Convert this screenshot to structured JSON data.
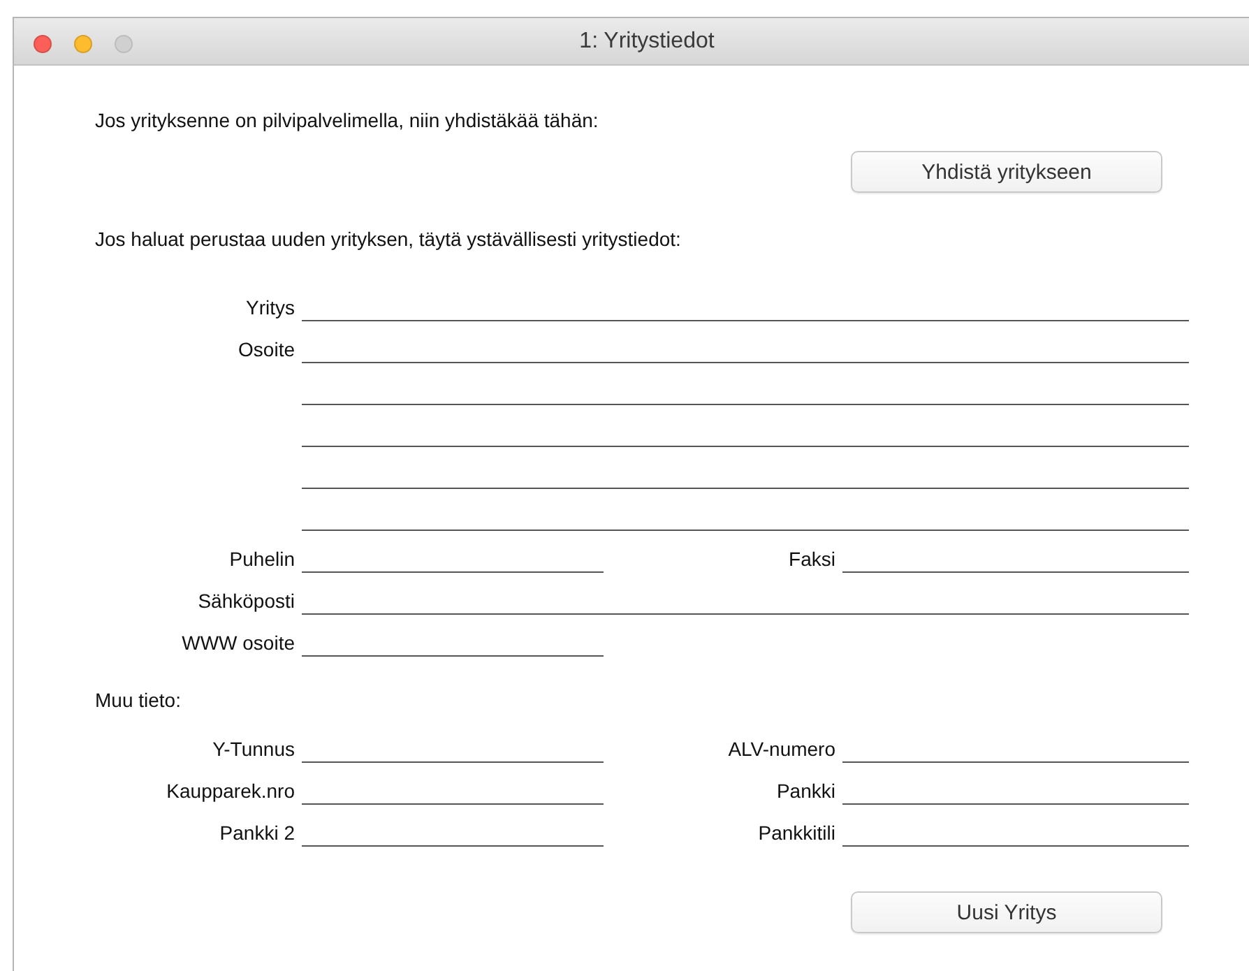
{
  "window": {
    "title": "1: Yritystiedot",
    "controls": [
      {
        "kind": "close",
        "disabled": false
      },
      {
        "kind": "minimize",
        "disabled": false
      },
      {
        "kind": "zoom",
        "disabled": true
      }
    ]
  },
  "connect": {
    "text": "Jos yrityksenne on pilvipalvelimella, niin yhdistäkää tähän:",
    "button": "Yhdistä yritykseen"
  },
  "new_company": {
    "text": "Jos haluat perustaa uuden yrityksen, täytä ystävällisesti yritystiedot:",
    "rows": [
      {
        "kind": "wide",
        "label": "Yritys"
      },
      {
        "kind": "wide",
        "label": "Osoite"
      },
      {
        "kind": "line"
      },
      {
        "kind": "line"
      },
      {
        "kind": "line"
      },
      {
        "kind": "line"
      },
      {
        "kind": "pair",
        "label": "Puhelin",
        "label_2": "Faksi"
      },
      {
        "kind": "wide",
        "label": "Sähköposti"
      },
      {
        "kind": "short",
        "label": "WWW osoite"
      }
    ]
  },
  "other": {
    "heading": "Muu tieto:",
    "rows": [
      {
        "kind": "pair",
        "label": "Y-Tunnus",
        "label_2": "ALV-numero"
      },
      {
        "kind": "pair",
        "label": "Kaupparek.nro",
        "label_2": "Pankki"
      },
      {
        "kind": "pair",
        "label": "Pankki 2",
        "label_2": "Pankkitili"
      }
    ],
    "button": "Uusi Yritys"
  }
}
